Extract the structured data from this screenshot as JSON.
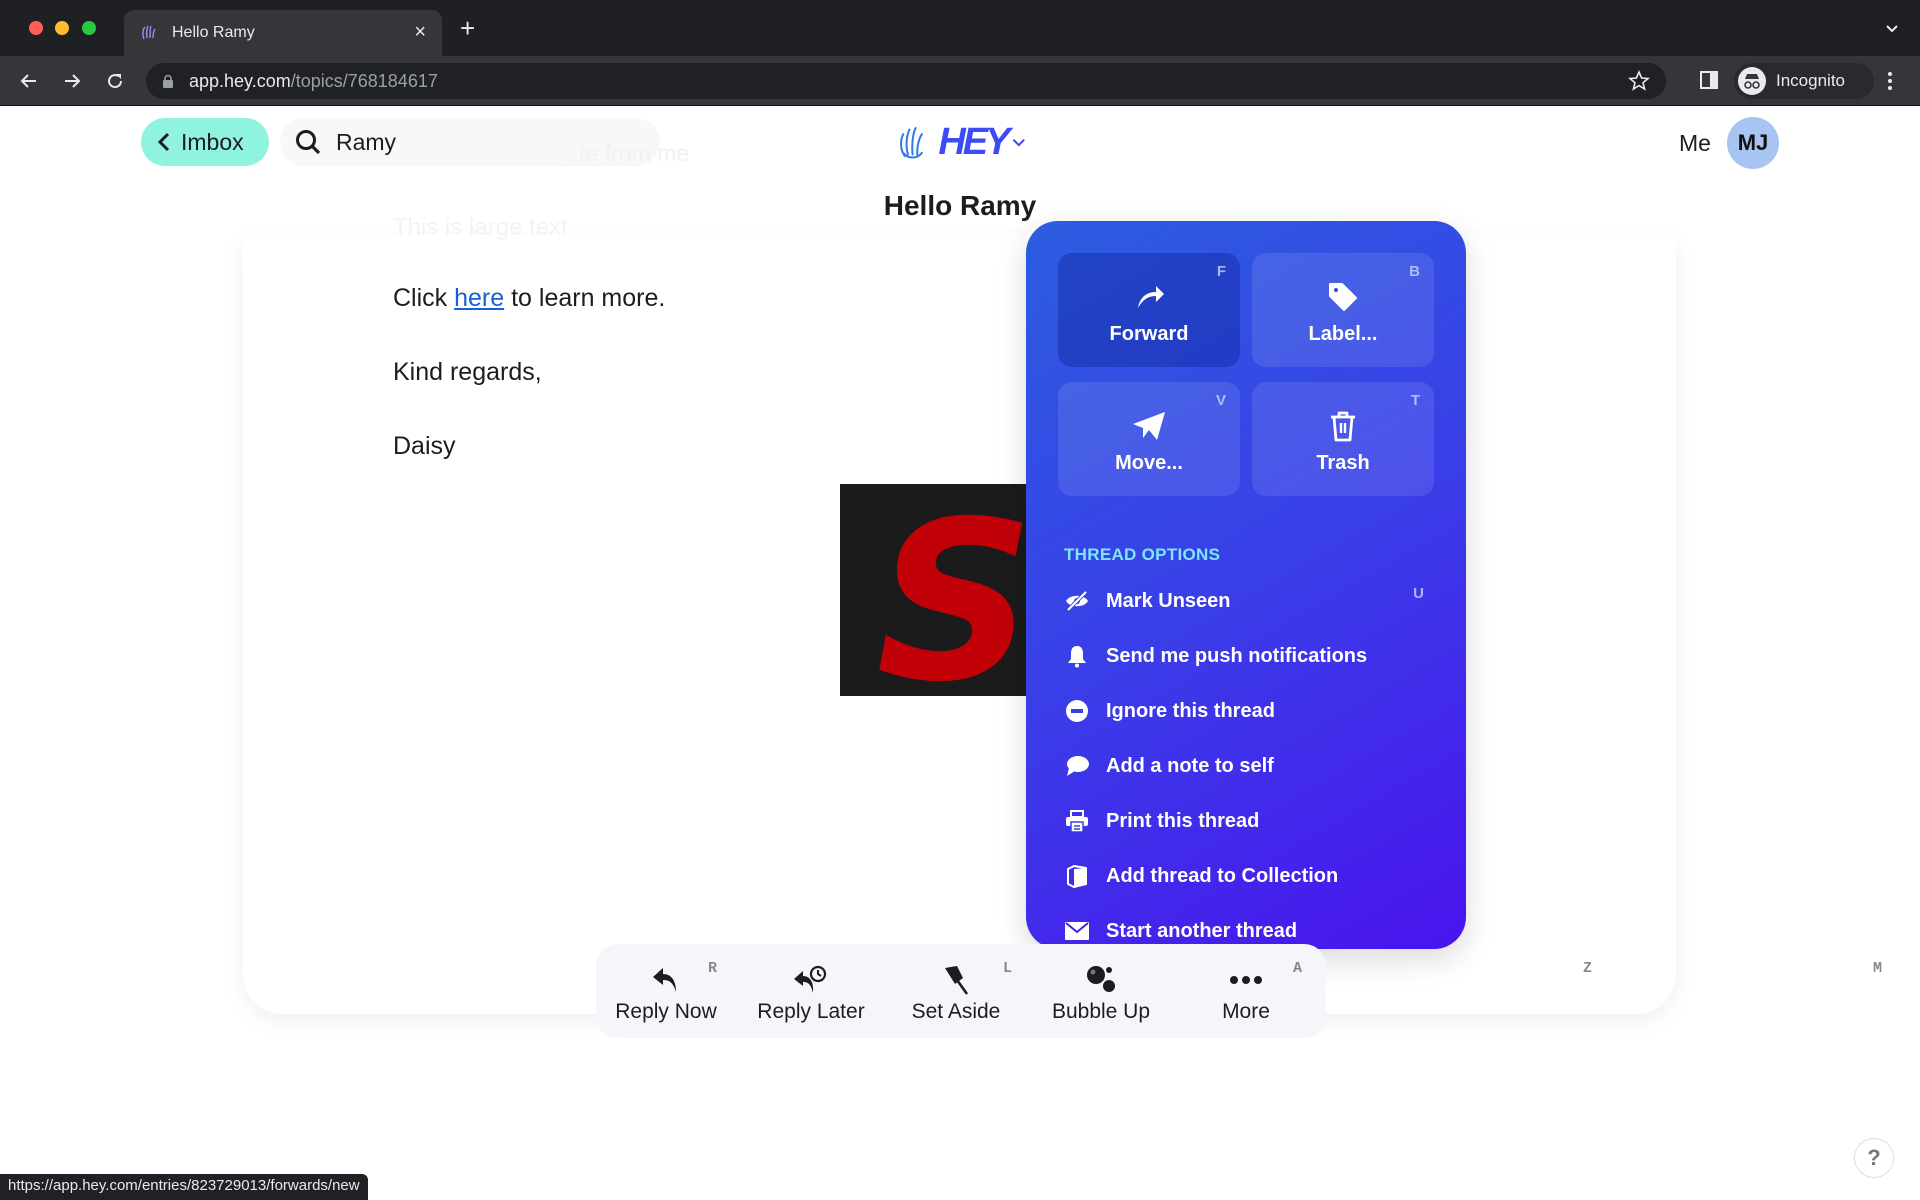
{
  "browser": {
    "tab_title": "Hello Ramy",
    "tab_close": "×",
    "new_tab": "+",
    "url_host": "app.hey.com",
    "url_path": "/topics/768184617",
    "profile_label": "Incognito",
    "status_url": "https://app.hey.com/entries/823729013/forwards/new"
  },
  "header": {
    "back_label": "Imbox",
    "search_value": "Ramy",
    "search_ghost_text": "...te from me",
    "logo_text": "HEY",
    "me_label": "Me",
    "avatar_initials": "MJ",
    "thread_title": "Hello Ramy"
  },
  "email": {
    "ghost_large_text": "This is large text",
    "click_prefix": "Click ",
    "link_text": "here",
    "click_suffix": " to learn more.",
    "closing": "Kind regards,",
    "signature": "Daisy",
    "image_letter": "S"
  },
  "more_menu": {
    "grid": [
      {
        "label": "Forward",
        "key": "F",
        "icon": "forward-icon"
      },
      {
        "label": "Label...",
        "key": "B",
        "icon": "tag-icon"
      },
      {
        "label": "Move...",
        "key": "V",
        "icon": "paper-plane-icon"
      },
      {
        "label": "Trash",
        "key": "T",
        "icon": "trash-icon"
      }
    ],
    "section_title": "THREAD OPTIONS",
    "options": [
      {
        "label": "Mark Unseen",
        "key": "U",
        "icon": "eye-slash-icon"
      },
      {
        "label": "Send me push notifications",
        "key": "",
        "icon": "bell-icon"
      },
      {
        "label": "Ignore this thread",
        "key": "",
        "icon": "minus-circle-icon"
      },
      {
        "label": "Add a note to self",
        "key": "",
        "icon": "speech-bubble-icon"
      },
      {
        "label": "Print this thread",
        "key": "",
        "icon": "printer-icon"
      },
      {
        "label": "Add thread to Collection",
        "key": "",
        "icon": "box-icon"
      },
      {
        "label": "Start another thread",
        "key": "",
        "icon": "envelope-icon"
      }
    ]
  },
  "actions": [
    {
      "label": "Reply Now",
      "key": "R",
      "icon": "reply-icon"
    },
    {
      "label": "Reply Later",
      "key": "L",
      "icon": "reply-later-icon"
    },
    {
      "label": "Set Aside",
      "key": "A",
      "icon": "pin-icon"
    },
    {
      "label": "Bubble Up",
      "key": "Z",
      "icon": "bubbles-icon"
    },
    {
      "label": "More",
      "key": "M",
      "icon": "ellipsis-icon"
    }
  ],
  "help_label": "?"
}
